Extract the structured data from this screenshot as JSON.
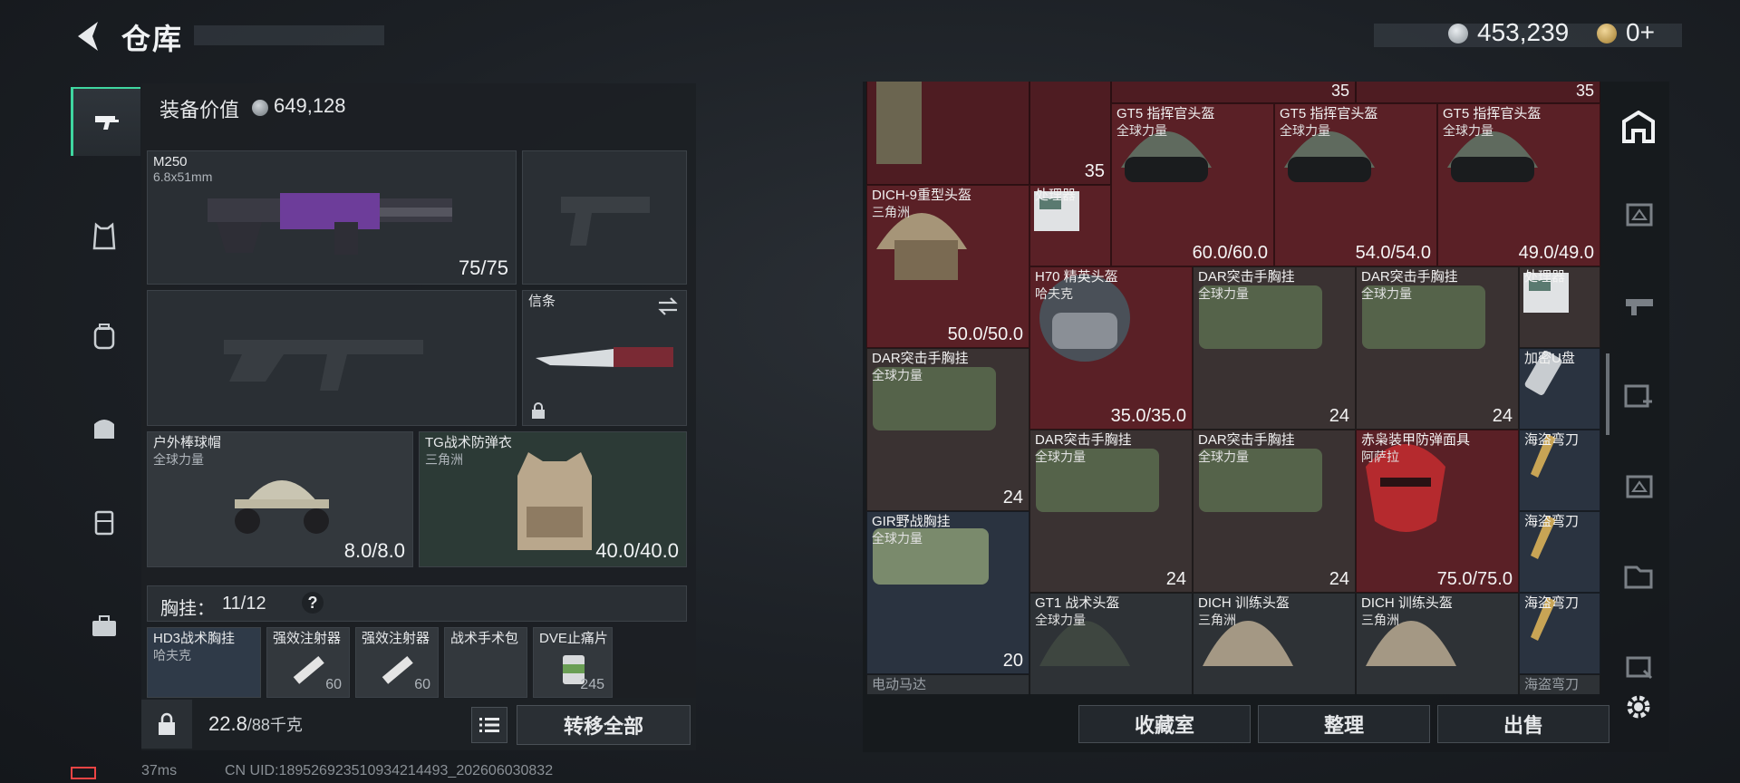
{
  "header": {
    "title": "仓库",
    "money": "453,239",
    "coupon": "0+"
  },
  "equipment": {
    "value_label": "装备价值",
    "value": "649,128"
  },
  "slots": {
    "primary": {
      "name": "M250",
      "caliber": "6.8x51mm",
      "ammo": "75/75"
    },
    "melee": {
      "name": "信条"
    },
    "helmet": {
      "name": "户外棒球帽",
      "source": "全球力量",
      "durability": "8.0/8.0"
    },
    "armor": {
      "name": "TG战术防弹衣",
      "source": "三角洲",
      "durability": "40.0/40.0"
    }
  },
  "chest_rig": {
    "label": "胸挂：",
    "capacity": "11/12",
    "help": "?",
    "items": [
      {
        "name": "HD3战术胸挂",
        "source": "哈夫克"
      },
      {
        "name": "强效注射器",
        "count": "60"
      },
      {
        "name": "强效注射器",
        "count": "60"
      },
      {
        "name": "战术手术包",
        "count": ""
      },
      {
        "name": "DVE止痛片",
        "count": "245"
      }
    ]
  },
  "weight": {
    "value": "22.8",
    "max": "/88千克"
  },
  "buttons": {
    "transfer_all": "转移全部",
    "collection": "收藏室",
    "sort": "整理",
    "sell": "出售"
  },
  "status_bar": {
    "ping": "37ms",
    "uid": "CN UID:18952692351093421449​3_202606030832"
  },
  "stash": {
    "top_counts": [
      "35",
      "35"
    ],
    "cells": [
      {
        "id": "c_vest_top",
        "name": "",
        "sub": "",
        "count": "35"
      },
      {
        "id": "c_gt5_1",
        "name": "GT5 指挥官头盔",
        "sub": "全球力量",
        "dur": "60.0/60.0"
      },
      {
        "id": "c_gt5_2",
        "name": "GT5 指挥官头盔",
        "sub": "全球力量",
        "dur": "54.0/54.0"
      },
      {
        "id": "c_gt5_3",
        "name": "GT5 指挥官头盔",
        "sub": "全球力量",
        "dur": "49.0/49.0"
      },
      {
        "id": "c_dich9",
        "name": "DICH-9重型头盔",
        "sub": "三角洲",
        "dur": "50.0/50.0"
      },
      {
        "id": "c_proc1",
        "name": "处理器",
        "sub": ""
      },
      {
        "id": "c_h70",
        "name": "H70 精英头盔",
        "sub": "哈夫克",
        "dur": "35.0/35.0"
      },
      {
        "id": "c_dar1",
        "name": "DAR突击手胸挂",
        "sub": "全球力量",
        "count": "24"
      },
      {
        "id": "c_dar2",
        "name": "DAR突击手胸挂",
        "sub": "全球力量",
        "count": "24"
      },
      {
        "id": "c_proc2",
        "name": "处理器",
        "sub": ""
      },
      {
        "id": "c_dar3",
        "name": "DAR突击手胸挂",
        "sub": "全球力量",
        "count": "24"
      },
      {
        "id": "c_usb",
        "name": "加密U盘",
        "sub": ""
      },
      {
        "id": "c_dar4",
        "name": "DAR突击手胸挂",
        "sub": "全球力量",
        "count": "24"
      },
      {
        "id": "c_dar5",
        "name": "DAR突击手胸挂",
        "sub": "全球力量",
        "count": "24"
      },
      {
        "id": "c_mask",
        "name": "赤枭装甲防弹面具",
        "sub": "阿萨拉",
        "dur": "75.0/75.0"
      },
      {
        "id": "c_knife1",
        "name": "海盗弯刀",
        "sub": ""
      },
      {
        "id": "c_gir",
        "name": "GIR野战胸挂",
        "sub": "全球力量",
        "count": "20"
      },
      {
        "id": "c_knife2",
        "name": "海盗弯刀",
        "sub": ""
      },
      {
        "id": "c_gt1",
        "name": "GT1 战术头盔",
        "sub": "全球力量"
      },
      {
        "id": "c_dich1",
        "name": "DICH 训练头盔",
        "sub": "三角洲"
      },
      {
        "id": "c_dich2",
        "name": "DICH 训练头盔",
        "sub": "三角洲"
      },
      {
        "id": "c_knife3",
        "name": "海盗弯刀",
        "sub": ""
      },
      {
        "id": "c_motor",
        "name": "电动马达",
        "sub": ""
      },
      {
        "id": "c_knife4",
        "name": "海盗弯刀",
        "sub": ""
      }
    ]
  },
  "icons": [
    "back-arrow-icon",
    "coin-icon",
    "coupon-icon",
    "rifle-icon",
    "vest-icon",
    "backpack-icon",
    "bag-icon",
    "case-icon",
    "toolbox-icon",
    "lock-icon",
    "swap-icon",
    "list-icon",
    "settings-icon",
    "gear-icon"
  ],
  "colors": {
    "accent": "#3fd6a0",
    "red_rarity": "#5a2026",
    "grey_slot": "#2a2f34"
  }
}
